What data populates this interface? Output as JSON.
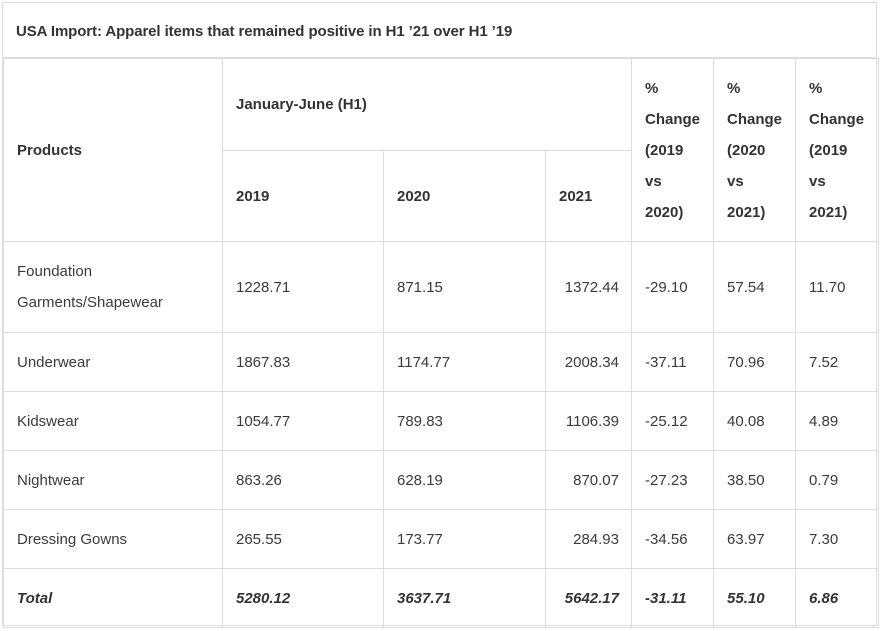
{
  "title": "USA Import: Apparel items that remained positive in H1 ’21 over H1 ’19",
  "header": {
    "products": "Products",
    "period": "January-June (H1)",
    "years": [
      "2019",
      "2020",
      "2021"
    ],
    "pct_cols": [
      [
        "%",
        "Change",
        "(2019",
        "vs",
        "2020)"
      ],
      [
        "%",
        "Change",
        "(2020",
        "vs",
        "2021)"
      ],
      [
        "%",
        "Change",
        "(2019",
        "vs",
        "2021)"
      ]
    ]
  },
  "rows": [
    {
      "product_line1": "Foundation",
      "product_line2": "Garments/Shapewear",
      "y2019": "1228.71",
      "y2020": "871.15",
      "y2021": "1372.44",
      "c1920": "-29.10",
      "c2021": "57.54",
      "c1921": "11.70"
    },
    {
      "product_line1": "Underwear",
      "product_line2": "",
      "y2019": "1867.83",
      "y2020": "1174.77",
      "y2021": "2008.34",
      "c1920": "-37.11",
      "c2021": "70.96",
      "c1921": "7.52"
    },
    {
      "product_line1": "Kidswear",
      "product_line2": "",
      "y2019": "1054.77",
      "y2020": "789.83",
      "y2021": "1106.39",
      "c1920": "-25.12",
      "c2021": "40.08",
      "c1921": "4.89"
    },
    {
      "product_line1": "Nightwear",
      "product_line2": "",
      "y2019": "863.26",
      "y2020": "628.19",
      "y2021": "870.07",
      "c1920": "-27.23",
      "c2021": "38.50",
      "c1921": "0.79"
    },
    {
      "product_line1": "Dressing Gowns",
      "product_line2": "",
      "y2019": "265.55",
      "y2020": "173.77",
      "y2021": "284.93",
      "c1920": "-34.56",
      "c2021": "63.97",
      "c1921": "7.30"
    }
  ],
  "total": {
    "label": "Total",
    "y2019": "5280.12",
    "y2020": "3637.71",
    "y2021": "5642.17",
    "c1920": "-31.11",
    "c2021": "55.10",
    "c1921": "6.86"
  }
}
